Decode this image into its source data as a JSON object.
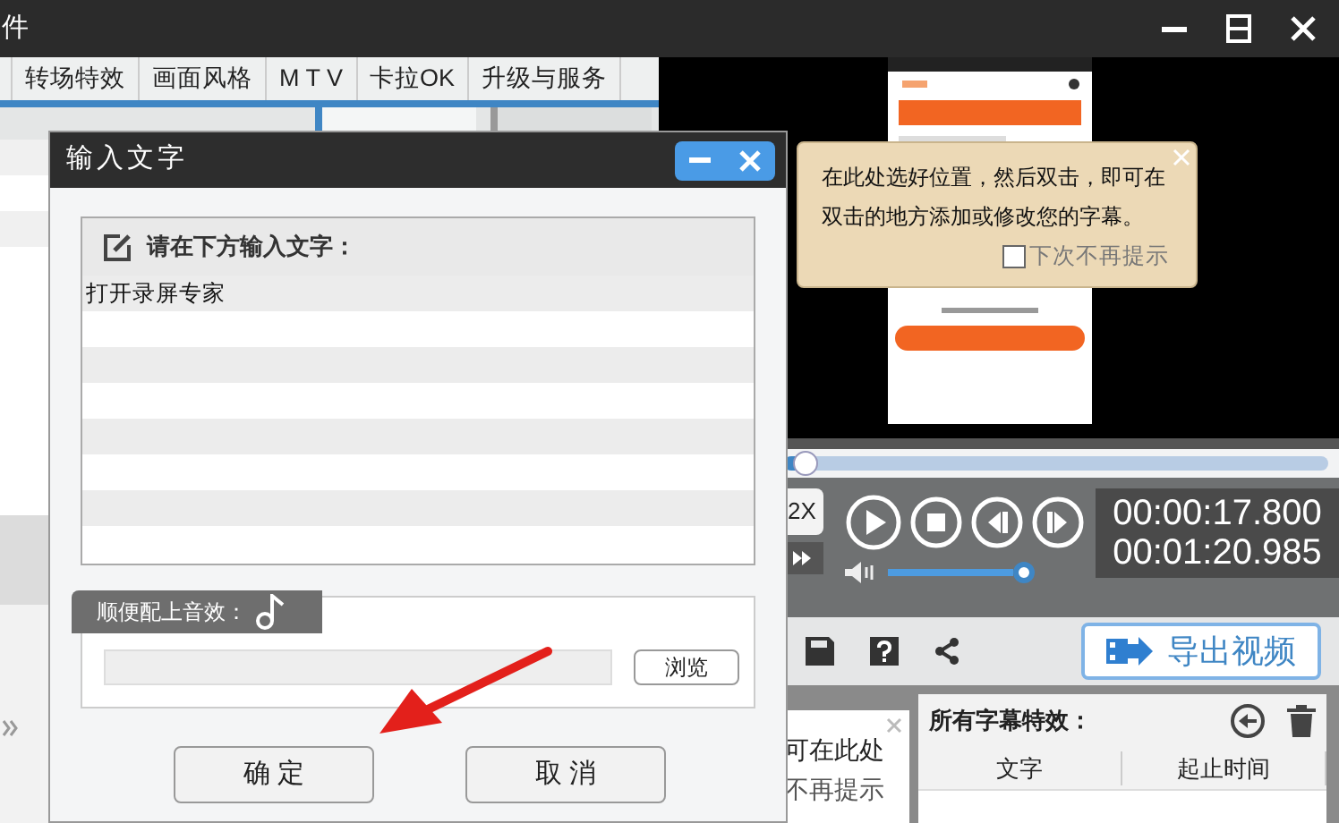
{
  "window": {
    "title": "件"
  },
  "menu": [
    {
      "label": "转场特效"
    },
    {
      "label": "画面风格"
    },
    {
      "label": "M T V"
    },
    {
      "label": "卡拉OK"
    },
    {
      "label": "升级与服务"
    }
  ],
  "player": {
    "progress": {
      "level": 0.04
    },
    "speed": "2X",
    "time_current": "00:00:17.800",
    "time_total": "00:01:20.985",
    "volume": {
      "level": 1.0
    },
    "export_button": "导出视频"
  },
  "tooltip": {
    "text": "在此处选好位置，然后双击，即可在双击的地方添加或修改您的字幕。",
    "checkbox": {
      "label": "下次不再提示",
      "checked": false
    }
  },
  "hint_fragment": {
    "lines": [
      "可在此处",
      "不再提示"
    ]
  },
  "subtitle_panel": {
    "title": "所有字幕特效：",
    "columns": [
      "文字",
      "起止时间"
    ]
  },
  "dialog": {
    "title": "输入文字",
    "prompt": "请在下方输入文字：",
    "value": "打开录屏专家",
    "sound_label": "顺便配上音效：",
    "browse_button": "浏览",
    "ok_button": "确 定",
    "cancel_button": "取 消"
  }
}
